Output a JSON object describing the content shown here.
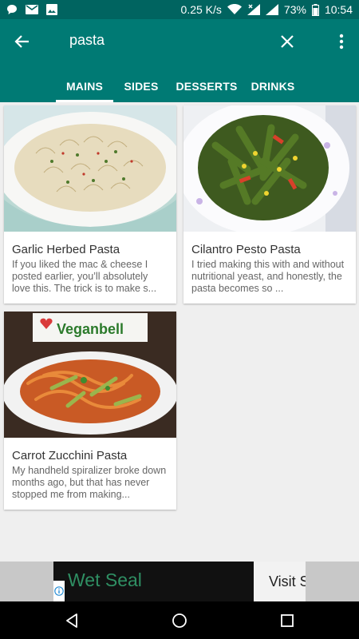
{
  "status_bar": {
    "speed": "0.25 K/s",
    "battery": "73%",
    "time": "10:54"
  },
  "search": {
    "query": "pasta"
  },
  "tabs": [
    {
      "label": "MAINS",
      "active": true
    },
    {
      "label": "SIDES",
      "active": false
    },
    {
      "label": "DESSERTS",
      "active": false
    },
    {
      "label": "DRINKS",
      "active": false
    }
  ],
  "recipes": [
    {
      "title": "Garlic Herbed Pasta",
      "description": "If you liked the mac & cheese I posted earlier, you’ll absolutely love this.   The trick is to make s..."
    },
    {
      "title": "Cilantro Pesto Pasta",
      "description": "I tried making this with and without nutritional yeast, and honestly, the pasta becomes so ..."
    },
    {
      "title": "Carrot Zucchini Pasta",
      "description": "My handheld spiralizer broke down months ago, but that has never stopped me from making...",
      "image_brand": "Veganbell"
    }
  ],
  "ad": {
    "brand": "Wet Seal",
    "cta": "Visit S"
  },
  "colors": {
    "app_bar": "#007a74",
    "status_bar": "#006460",
    "background": "#efefef"
  }
}
